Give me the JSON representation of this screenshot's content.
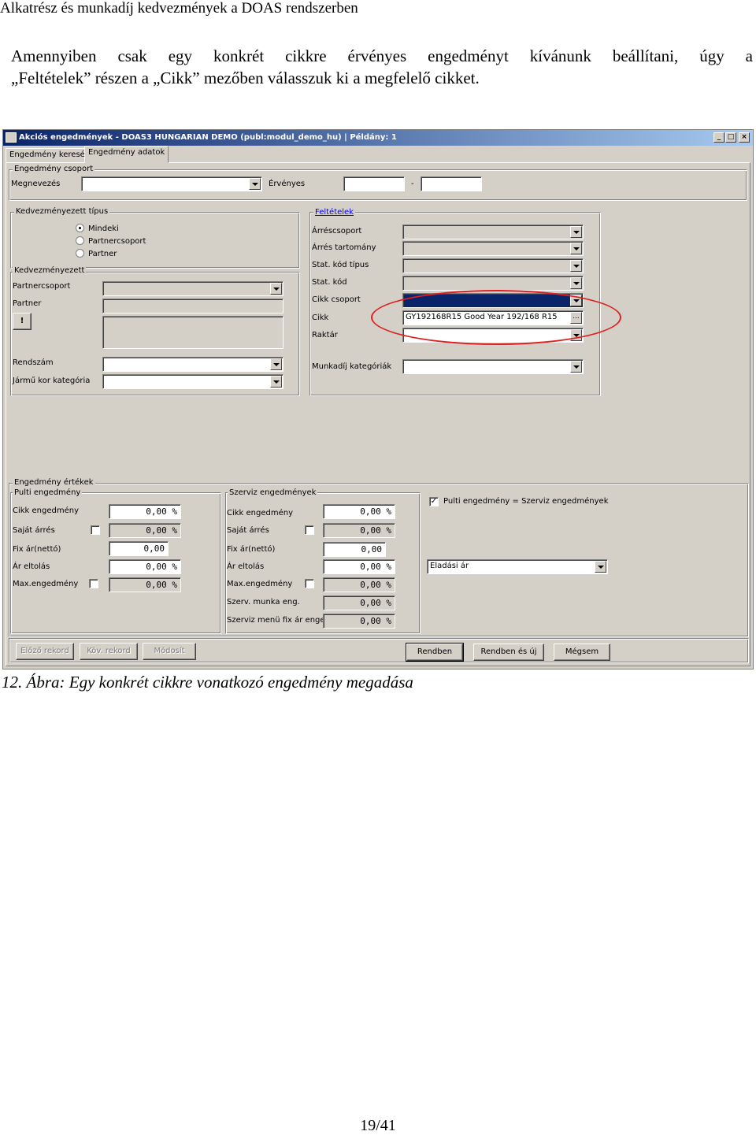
{
  "doc": {
    "header": "Alkatrész és munkadíj kedvezmények a DOAS rendszerben",
    "para_line1": "Amennyiben csak egy konkrét cikkre érvényes engedményt kívánunk beállítani, úgy a",
    "para_line2": "„Feltételek” részen a „Cikk” mezőben válasszuk ki a megfelelő cikket.",
    "caption": "12. Ábra: Egy konkrét cikkre vonatkozó engedmény megadása",
    "page": "19/41"
  },
  "window": {
    "title": "Akciós engedmények - DOAS3 HUNGARIAN DEMO (publ:modul_demo_hu) | Példány: 1",
    "buttons": {
      "minimize": "_",
      "maximize": "□",
      "close": "×"
    }
  },
  "tabs": [
    "Engedmény keresés",
    "Engedmény adatok"
  ],
  "group_csoport": {
    "legend": "Engedmény csoport",
    "megnevezes": "Megnevezés",
    "ervenyes": "Érvényes",
    "dash": "-"
  },
  "tipus": {
    "legend": "Kedvezményezett típus",
    "options": [
      "Mindeki",
      "Partnercsoport",
      "Partner"
    ],
    "selected": 0
  },
  "kedv": {
    "legend": "Kedvezményezett",
    "partnercsoport": "Partnercsoport",
    "partner": "Partner",
    "excl": "!",
    "rendszam": "Rendszám",
    "jarmu": "Jármű kor kategória"
  },
  "feltetelek": {
    "legend": "Feltételek",
    "arrescsoport": "Árréscsoport",
    "arres_tartomany": "Árrés tartomány",
    "stat_kod_tipus": "Stat. kód típus",
    "stat_kod": "Stat. kód",
    "cikk_csoport": "Cikk csoport",
    "cikk": "Cikk",
    "cikk_value": "GY192168R15 Good Year 192/168 R15",
    "cikk_btn": "...",
    "raktar": "Raktár",
    "munkadij": "Munkadíj kategóriák"
  },
  "ertekek": {
    "legend": "Engedmény értékek",
    "pulti": {
      "legend": "Pulti engedmény",
      "cikk": "Cikk engedmény",
      "sajat": "Saját árrés",
      "fix": "Fix ár(nettó)",
      "eltolas": "Ár eltolás",
      "max": "Max.engedmény",
      "v_cikk": "0,00 %",
      "v_sajat": "0,00 %",
      "v_fix": "0,00",
      "v_eltolas": "0,00 %",
      "v_max": "0,00 %"
    },
    "szerviz": {
      "legend": "Szerviz  engedmények",
      "cikk": "Cikk engedmény",
      "sajat": "Saját árrés",
      "fix": "Fix ár(nettó)",
      "eltolas": "Ár eltolás",
      "max": "Max.engedmény",
      "munka": "Szerv. munka eng.",
      "menu": "Szerviz menü fix ár engedm",
      "v_cikk": "0,00 %",
      "v_sajat": "0,00 %",
      "v_fix": "0,00",
      "v_eltolas": "0,00 %",
      "v_max": "0,00 %",
      "v_munka": "0,00 %",
      "v_menu": "0,00 %"
    },
    "pulti_eq": "Pulti engedmény = Szerviz  engedmények",
    "check": "✓",
    "eladasi": "Eladási ár"
  },
  "footer": {
    "elozo": "Előző rekord",
    "kov": "Köv. rekord",
    "modosit": "Módosít",
    "rendben": "Rendben",
    "rendben_uj": "Rendben és új",
    "megsem": "Mégsem"
  }
}
